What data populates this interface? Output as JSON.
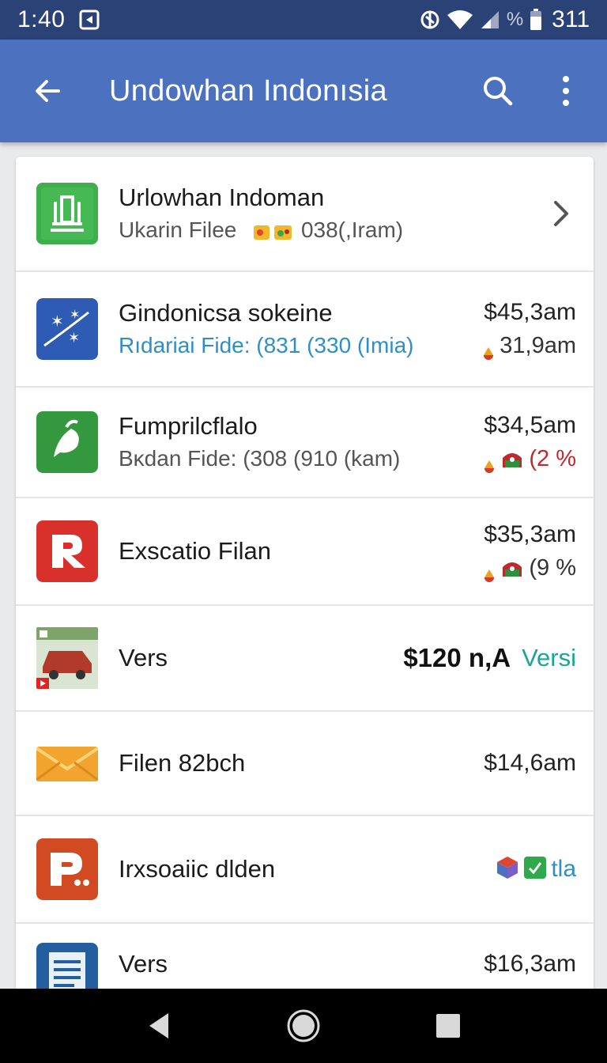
{
  "status_bar": {
    "time": "1:40",
    "percent_symbol": "%",
    "battery_level": "311"
  },
  "app_bar": {
    "title": "Undowhan Indonısia"
  },
  "list": [
    {
      "title": "Urlowhan Indoman",
      "subtitle": "Ukarin Filee",
      "subtitle_extra": "038(,Iram)"
    },
    {
      "title": "Gindonicsa sokeine",
      "subtitle": "Rıdariai Fide: (831 (330 (Imia)",
      "price": "$45,3am",
      "secondary": "31,9am"
    },
    {
      "title": "Fumprilcflalo",
      "subtitle": "Bκdan Fide: (308 (910 (kam)",
      "price": "$34,5am",
      "secondary": "(2 %"
    },
    {
      "title": "Exscatio Filan",
      "price": "$35,3am",
      "secondary": "(9 %"
    },
    {
      "title": "Vers",
      "price": "$120 n,A",
      "badge": "Versi"
    },
    {
      "title": "Filen 82bch",
      "price": "$14,6am"
    },
    {
      "title": "Irxsoaiic dlden",
      "badge": "tla"
    },
    {
      "title": "Vers",
      "price": "$16,3am"
    }
  ],
  "colors": {
    "status_bar": "#2b4277",
    "app_bar": "#4b71bf",
    "accent_blue": "#2e8fc7",
    "teal": "#1aa59a",
    "red": "#c0282d"
  },
  "icons": {
    "back": "arrow-back-icon",
    "search": "search-icon",
    "more": "more-vert-icon",
    "chevron": "chevron-right-icon",
    "nav_back": "triangle-back-icon",
    "nav_home": "circle-home-icon",
    "nav_recent": "square-recents-icon"
  }
}
